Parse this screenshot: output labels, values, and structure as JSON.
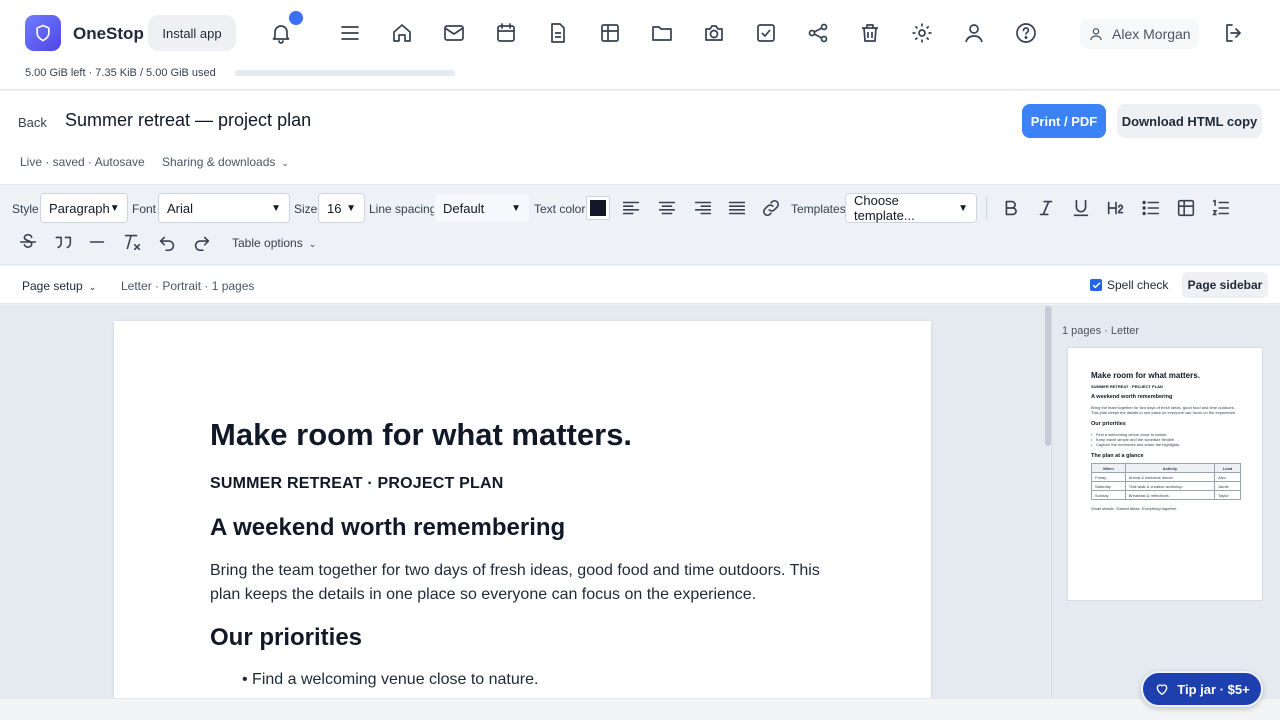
{
  "app": {
    "name": "OneStop",
    "install_label": "Install app",
    "storage_text": "5.00 GiB left · 7.35 KiB / 5.00 GiB used",
    "storage_used_fraction": 1.4e-06
  },
  "nav_icons": [
    "bell-icon",
    "menu-icon",
    "home-icon",
    "mail-icon",
    "calendar-icon",
    "document-icon",
    "table-icon",
    "folder-icon",
    "camera-icon",
    "checkbox-icon",
    "share-icon",
    "trash-icon",
    "gear-icon",
    "user-icon",
    "help-icon"
  ],
  "user": {
    "name": "Alex Morgan"
  },
  "doc": {
    "back_label": "Back",
    "title": "Summer retreat — project plan",
    "print_label": "Print / PDF",
    "download_label": "Download HTML copy",
    "status": "Live · saved · Autosave",
    "sharing_label": "Sharing & downloads"
  },
  "toolbar": {
    "style_label": "Style",
    "style_value": "Paragraph",
    "font_label": "Font",
    "font_value": "Arial",
    "size_label": "Size",
    "size_value": "16",
    "spacing_label": "Line spacing",
    "spacing_value": "Default",
    "color_label": "Text color",
    "text_color": "#111827",
    "templates_label": "Templates",
    "templates_value": "Choose template...",
    "table_options_label": "Table options"
  },
  "page_bar": {
    "setup_label": "Page setup",
    "info": "Letter · Portrait · 1 pages",
    "spell_label": "Spell check",
    "spell_checked": true,
    "sidebar_label": "Page sidebar"
  },
  "content": {
    "h1": "Make room for what matters.",
    "subtitle": "SUMMER RETREAT · PROJECT PLAN",
    "h2_1": "A weekend worth remembering",
    "body": "Bring the team together for two days of fresh ideas, good food and time outdoors. This plan keeps the details in one place so everyone can focus on the experience.",
    "h2_2": "Our priorities",
    "list": [
      "Find a welcoming venue close to nature.",
      "Keep travel simple and the schedule flexible.",
      "Capture the memories and share the highlights."
    ],
    "h2_3": "The plan at a glance",
    "table_headers": [
      "When",
      "Activity",
      "Lead"
    ],
    "table_rows": [
      [
        "Friday",
        "Arrival & welcome dinner",
        "Alex"
      ],
      [
        "Saturday",
        "Trail walk & creative workshop",
        "Jamie"
      ],
      [
        "Sunday",
        "Breakfast & reflections",
        "Taylor"
      ]
    ],
    "footer": "Small details. Shared ideas. Everything together."
  },
  "sidebar": {
    "label": "1 pages · Letter"
  },
  "tip": {
    "label": "Tip jar · $5+"
  }
}
